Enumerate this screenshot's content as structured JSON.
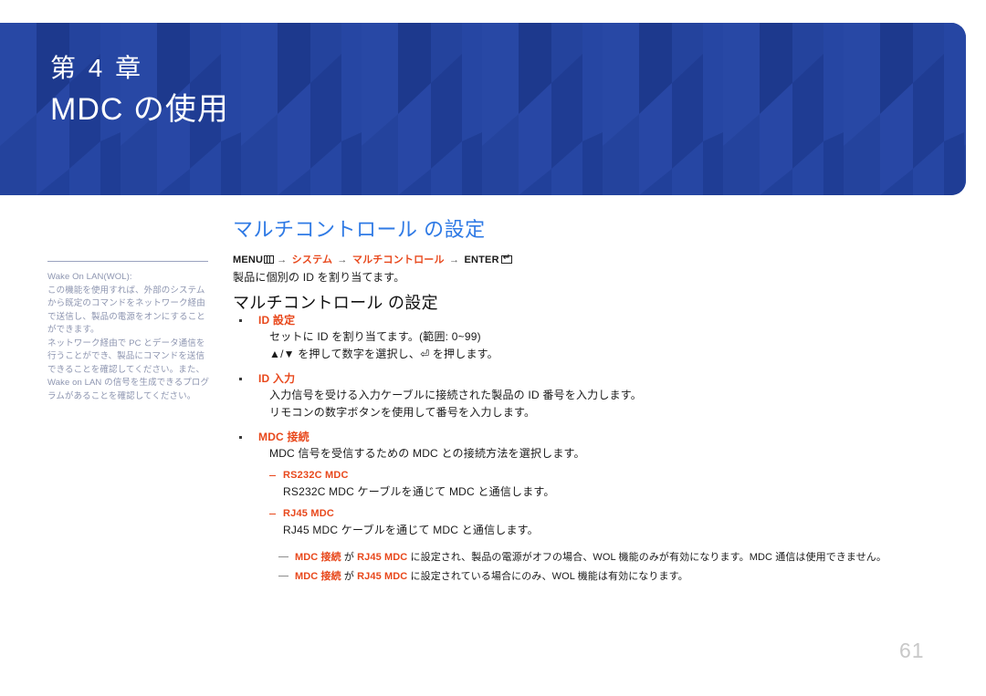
{
  "banner": {
    "chapter_number": "第 4 章",
    "chapter_title": "MDC の使用",
    "bg_color": "#21409a",
    "pattern_light": "#2a4aa8",
    "pattern_dark": "#1c3789"
  },
  "section": {
    "heading": "マルチコントロール の設定",
    "heading_color": "#2f7ae5"
  },
  "menu_path": {
    "menu_label": "MENU",
    "menu_icon": "menu-grid-icon",
    "arrow1": "→",
    "item1": "システム",
    "arrow2": "→",
    "item2": "マルチコントロール",
    "arrow3": "→",
    "enter_label": "ENTER",
    "enter_icon": "enter-key-icon",
    "highlight_color": "#e8481c"
  },
  "lead": "製品に個別の ID を割り当てます。",
  "sub_heading": "マルチコントロール の設定",
  "bullets": [
    {
      "title": "ID 設定",
      "lines": [
        "セットに ID を割り当てます。(範囲: 0~99)",
        "▲/▼ を押して数字を選択し、⏎ を押します。"
      ]
    },
    {
      "title": "ID 入力",
      "lines": [
        "入力信号を受ける入力ケーブルに接続された製品の ID 番号を入力します。",
        "リモコンの数字ボタンを使用して番号を入力します。"
      ]
    },
    {
      "title": "MDC 接続",
      "lines": [
        "MDC 信号を受信するための MDC との接続方法を選択します。"
      ]
    }
  ],
  "sub_items": [
    {
      "title": "RS232C MDC",
      "body": "RS232C MDC ケーブルを通じて MDC と通信します。"
    },
    {
      "title": "RJ45 MDC",
      "body": "RJ45 MDC ケーブルを通じて MDC と通信します。"
    }
  ],
  "notes": [
    {
      "p1": "MDC 接続",
      "p2": " が ",
      "p3": "RJ45 MDC",
      "p4": " に設定され、製品の電源がオフの場合、WOL 機能のみが有効になります。MDC 通信は使用できません。"
    },
    {
      "p1": "MDC 接続",
      "p2": " が ",
      "p3": "RJ45 MDC",
      "p4": " に設定されている場合にのみ、WOL 機能は有効になります。"
    }
  ],
  "sidenote": {
    "title": "Wake On LAN(WOL):",
    "para1": "この機能を使用すれば、外部のシステムから既定のコマンドをネットワーク経由で送信し、製品の電源をオンにすることができます。",
    "para2": "ネットワーク経由で PC とデータ通信を行うことができ、製品にコマンドを送信できることを確認してください。また、Wake on LAN の信号を生成できるプログラムがあることを確認してください。",
    "text_color": "#8d95b0"
  },
  "page_number": "61"
}
